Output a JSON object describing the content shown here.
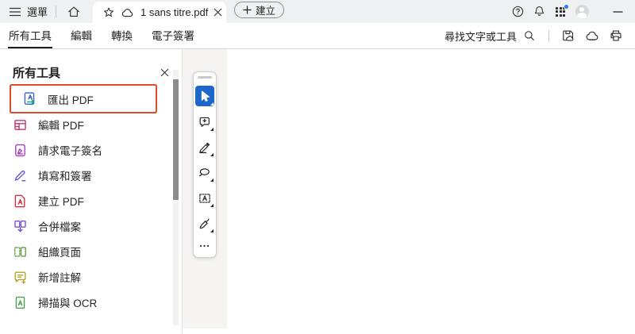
{
  "colors": {
    "topbar-bg": "#eef0f2",
    "accent-blue": "#1e66c9",
    "badge-blue": "#2a7de1",
    "highlight-red": "#de4c2c",
    "icon-export-arrow": "#0aa27e"
  },
  "tabbar": {
    "menu_label": "選單",
    "tab": {
      "title": "1 sans titre.pdf"
    },
    "create_label": "建立"
  },
  "toolbar": {
    "tabs": [
      {
        "label": "所有工具",
        "active": true
      },
      {
        "label": "編輯",
        "active": false
      },
      {
        "label": "轉換",
        "active": false
      },
      {
        "label": "電子簽署",
        "active": false
      }
    ],
    "find_label": "尋找文字或工具"
  },
  "panel": {
    "title": "所有工具",
    "items": [
      {
        "label": "匯出 PDF",
        "icon": "export-pdf-icon",
        "color": "#3a63c8",
        "highlighted": true
      },
      {
        "label": "編輯 PDF",
        "icon": "edit-pdf-icon",
        "color": "#c03574"
      },
      {
        "label": "請求電子簽名",
        "icon": "request-esign-icon",
        "color": "#a33bbf"
      },
      {
        "label": "填寫和簽署",
        "icon": "fill-sign-icon",
        "color": "#6f52d8"
      },
      {
        "label": "建立 PDF",
        "icon": "create-pdf-icon",
        "color": "#d2313d"
      },
      {
        "label": "合併檔案",
        "icon": "combine-files-icon",
        "color": "#7a4fd0"
      },
      {
        "label": "組織頁面",
        "icon": "organize-pages-icon",
        "color": "#5f9e44"
      },
      {
        "label": "新增註解",
        "icon": "add-comments-icon",
        "color": "#b5a02e"
      },
      {
        "label": "掃描與 OCR",
        "icon": "scan-ocr-icon",
        "color": "#4d9e53"
      }
    ]
  },
  "quicktools": {
    "tools": [
      "select-tool",
      "add-comment-tool",
      "highlight-tool",
      "lasso-tool",
      "add-text-tool",
      "sign-tool",
      "more-tools"
    ],
    "selected_tool": "select-tool",
    "more_label": "..."
  },
  "icons": {
    "hamburger-icon": "three horizontal lines",
    "home-icon": "house outline",
    "star-icon": "star outline",
    "cloud-icon": "cloud outline",
    "close-icon": "x",
    "plus-icon": "+",
    "help-icon": "? in circle",
    "bell-icon": "notification bell",
    "apps-grid-icon": "3x3 dot grid with blue badge",
    "avatar-icon": "grey person circle",
    "minimize-icon": "dash",
    "search-icon": "magnifier",
    "save-icon": "floppy disk with cloud",
    "cloud-upload-icon": "cloud with dots",
    "print-icon": "printer"
  }
}
